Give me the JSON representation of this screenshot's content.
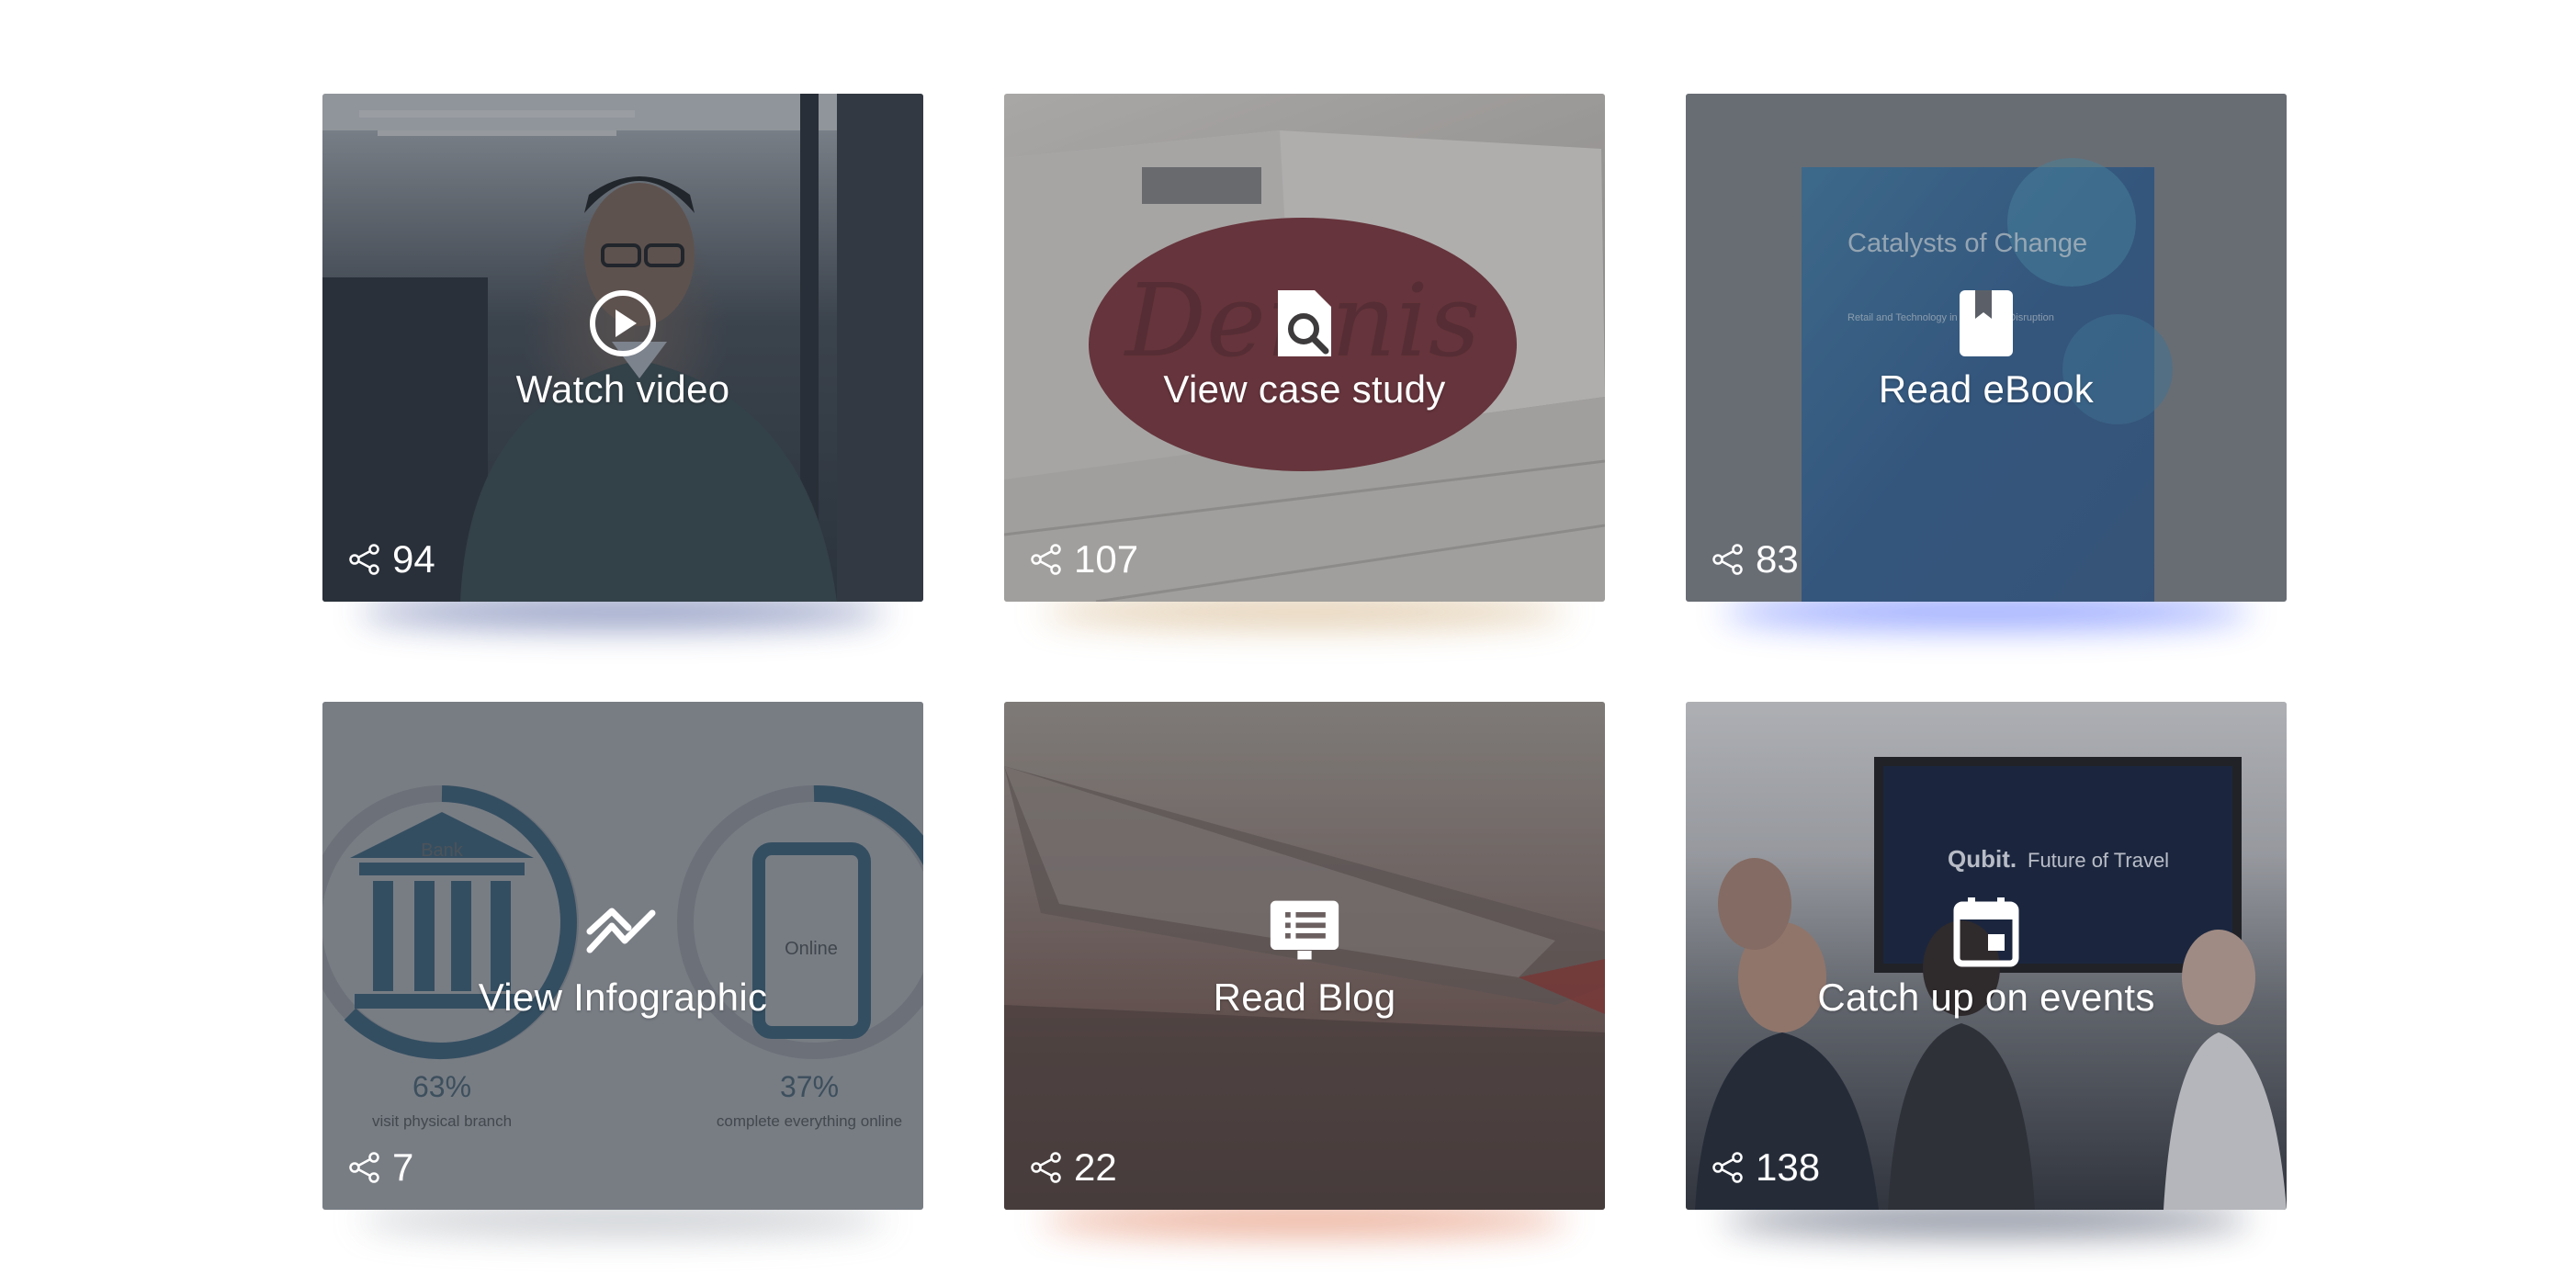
{
  "cards": [
    {
      "label": "Watch video",
      "icon": "play-circle-icon",
      "shares": "94"
    },
    {
      "label": "View case study",
      "icon": "document-search-icon",
      "shares": "107",
      "logo_text": "Dennis"
    },
    {
      "label": "Read eBook",
      "icon": "book-icon",
      "shares": "83",
      "book_title": "Catalysts of Change",
      "book_subtitle": "Retail and Technology in the Age of Disruption"
    },
    {
      "label": "View Infographic",
      "icon": "trend-chart-icon",
      "shares": "7",
      "bank_label": "Bank",
      "online_label": "Online",
      "left_percent": "63%",
      "left_caption": "visit physical branch",
      "right_percent": "37%",
      "right_caption": "complete everything online"
    },
    {
      "label": "Read Blog",
      "icon": "blog-monitor-icon",
      "shares": "22"
    },
    {
      "label": "Catch up on events",
      "icon": "calendar-icon",
      "shares": "138",
      "screen_brand": "Qubit.",
      "screen_text": "Future of Travel"
    }
  ],
  "colors": {
    "overlay": "#5b6068",
    "text": "#ffffff",
    "case_logo": "#7a2730"
  }
}
